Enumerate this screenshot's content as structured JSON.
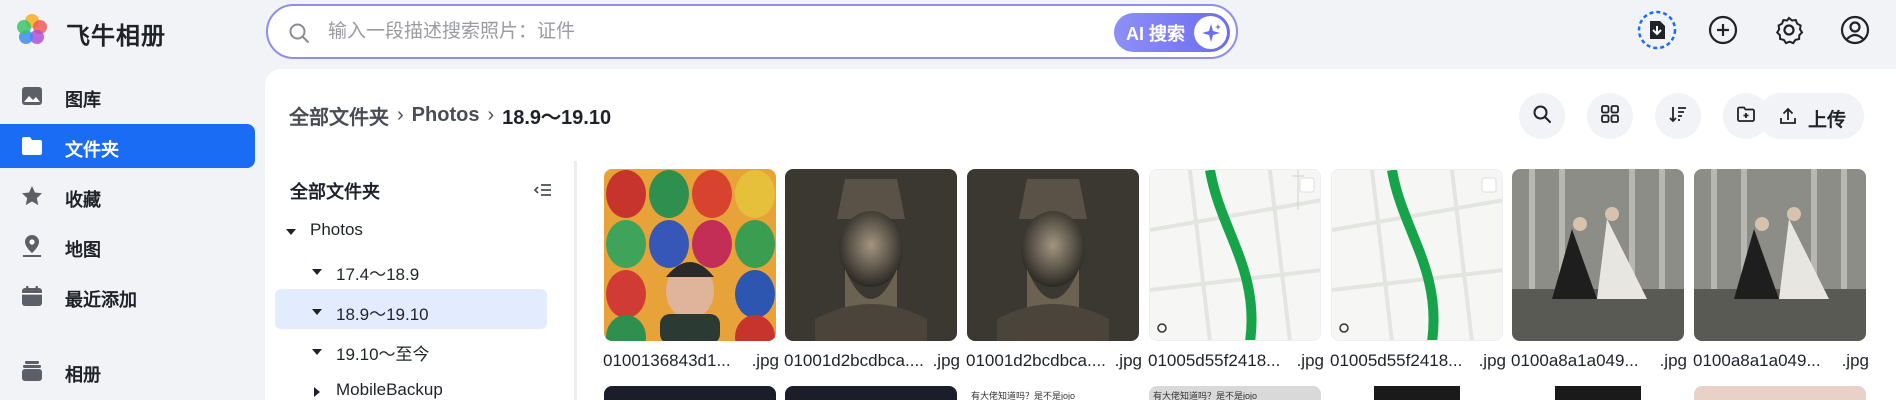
{
  "app": {
    "title": "飞牛相册"
  },
  "search": {
    "placeholder": "输入一段描述搜索照片：证件",
    "ai_label": "AI 搜索"
  },
  "top_icons": [
    "task-progress-icon",
    "add-circle-icon",
    "settings-gear-icon",
    "user-avatar-icon"
  ],
  "sidebar": {
    "items": [
      {
        "label": "图库",
        "icon": "gallery-icon",
        "active": false
      },
      {
        "label": "文件夹",
        "icon": "folder-icon",
        "active": true
      },
      {
        "label": "收藏",
        "icon": "star-icon",
        "active": false
      },
      {
        "label": "地图",
        "icon": "map-pin-icon",
        "active": false
      },
      {
        "label": "最近添加",
        "icon": "calendar-icon",
        "active": false
      },
      {
        "label": "相册",
        "icon": "album-stack-icon",
        "active": false
      }
    ]
  },
  "breadcrumb": {
    "root": "全部文件夹",
    "middle": "Photos",
    "current": "18.9～19.10"
  },
  "toolbar": {
    "upload_label": "上传"
  },
  "tree": {
    "title": "全部文件夹",
    "items": [
      {
        "label": "Photos",
        "expanded": true,
        "selected": false
      },
      {
        "label": "17.4～18.9",
        "expanded": true,
        "selected": false
      },
      {
        "label": "18.9～19.10",
        "expanded": true,
        "selected": true
      },
      {
        "label": "19.10～至今",
        "expanded": true,
        "selected": false
      },
      {
        "label": "MobileBackup",
        "expanded": false,
        "selected": false
      }
    ]
  },
  "photos": [
    {
      "name": "0100136843d1...",
      "ext": ".jpg"
    },
    {
      "name": "01001d2bcdbca....",
      "ext": ".jpg"
    },
    {
      "name": "01001d2bcdbca....",
      "ext": ".jpg"
    },
    {
      "name": "01005d55f2418...",
      "ext": ".jpg"
    },
    {
      "name": "01005d55f2418...",
      "ext": ".jpg"
    },
    {
      "name": "0100a8a1a049...",
      "ext": ".jpg"
    },
    {
      "name": "0100a8a1a049...",
      "ext": ".jpg"
    }
  ],
  "second_row_captions": [
    "有大佬知道吗？是不是jojo",
    "有大佬知道吗？是不是jojo"
  ],
  "colors": {
    "accent": "#1a6cf5",
    "ai_gradient_start": "#8e8ff7",
    "ai_gradient_end": "#6b6cf0",
    "selected_bg": "#e3ecfe"
  }
}
